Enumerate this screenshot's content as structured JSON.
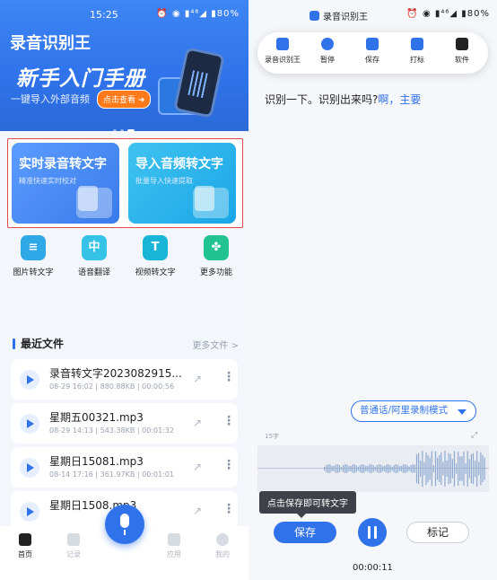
{
  "left": {
    "status": {
      "time": "15:25",
      "icons": "⏰ ◉ ▮⁴⁶◢ ▮80%"
    },
    "hero": {
      "app_title": "录音识别王",
      "headline": "新手入门手册",
      "subtitle": "一键导入外部音频",
      "button": "点击查看 ➜"
    },
    "cards": [
      {
        "title": "实时录音转文字",
        "subtitle": "精准快速实时校对"
      },
      {
        "title": "导入音频转文字",
        "subtitle": "批量导入快速提取"
      }
    ],
    "tools": [
      {
        "label": "图片转文字",
        "icon": "image-text-icon",
        "color": "#2fa8e8",
        "glyph": "≡"
      },
      {
        "label": "语音翻译",
        "icon": "translate-icon",
        "color": "#34c3e6",
        "glyph": "中"
      },
      {
        "label": "视频转文字",
        "icon": "video-text-icon",
        "color": "#19b5d8",
        "glyph": "T"
      },
      {
        "label": "更多功能",
        "icon": "grid-more-icon",
        "color": "#22c38e",
        "glyph": "✤"
      }
    ],
    "recent": {
      "title": "最近文件",
      "more": "更多文件 >",
      "files": [
        {
          "name": "录音转文字2023082915...",
          "meta": "08-29 16:02 | 880.88KB | 00:00:56"
        },
        {
          "name": "星期五00321.mp3",
          "meta": "08-29 14:13 | 543.38KB | 00:01:32"
        },
        {
          "name": "星期日15081.mp3",
          "meta": "08-14 17:16 | 361.97KB | 00:01:01"
        },
        {
          "name": "星期日1508.mp3",
          "meta": ""
        }
      ]
    },
    "nav": [
      {
        "label": "首页",
        "icon": "home-icon"
      },
      {
        "label": "记录",
        "icon": "record-list-icon"
      },
      {
        "label": "应用",
        "icon": "apps-icon"
      },
      {
        "label": "我的",
        "icon": "profile-icon"
      }
    ]
  },
  "right": {
    "status": {
      "app": "录音识别王",
      "icons": "⏰ ◉ ▮⁴⁶◢ ▮80%"
    },
    "toolbar": [
      {
        "label": "录音识别王",
        "icon": "app-logo-icon"
      },
      {
        "label": "暂停",
        "icon": "pause-icon"
      },
      {
        "label": "保存",
        "icon": "save-icon"
      },
      {
        "label": "打标",
        "icon": "flag-icon"
      },
      {
        "label": "软件",
        "icon": "software-icon"
      }
    ],
    "transcript": {
      "text": "识别一下。识别出来吗?",
      "highlight": "啊，主要"
    },
    "mode": "普通话/阿里录制模式",
    "char_count": "15字",
    "tooltip": "点击保存即可转文字",
    "buttons": {
      "save": "保存",
      "mark": "标记"
    },
    "timer": "00:00:11"
  }
}
